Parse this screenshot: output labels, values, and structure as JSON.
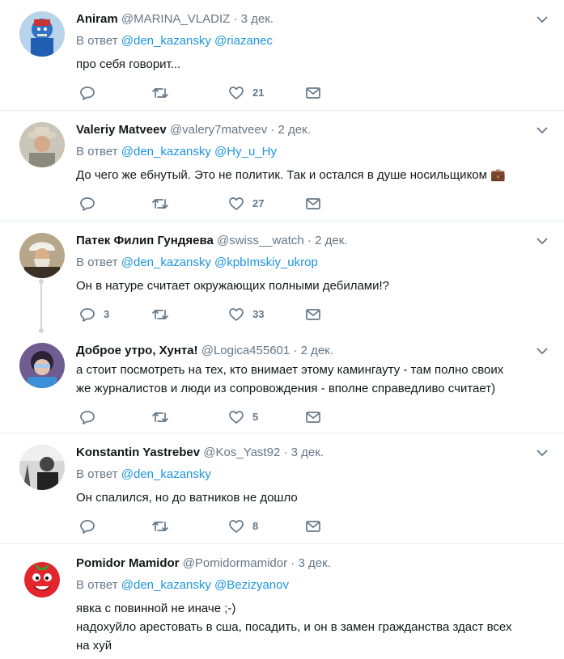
{
  "reply_prefix": "В ответ",
  "tweets": [
    {
      "name": "Aniram",
      "handle": "@MARINA_VLADIZ",
      "separator": "·",
      "time": "3 дек.",
      "mentions": [
        "@den_kazansky",
        "@riazanec"
      ],
      "lines": [
        "про себя говорит..."
      ],
      "replies": "",
      "likes": "21"
    },
    {
      "name": "Valeriy Matveev",
      "handle": "@valery7matveev",
      "separator": "·",
      "time": "2 дек.",
      "mentions": [
        "@den_kazansky",
        "@Hy_u_Hy"
      ],
      "lines": [
        "До чего же ебнутый. Это не политик. Так и остался в душе носильщиком"
      ],
      "emoji": "💼",
      "replies": "",
      "likes": "27"
    },
    {
      "name": "Патек Филип Гундяева",
      "handle": "@swiss__watch",
      "separator": "·",
      "time": "2 дек.",
      "mentions": [
        "@den_kazansky",
        "@kpbImskiy_ukrop"
      ],
      "lines": [
        "Он в натуре считает окружающих полными дебилами!?"
      ],
      "replies": "3",
      "likes": "33"
    },
    {
      "name": "Доброе утро, Хунта!",
      "handle": "@Logica455601",
      "separator": "·",
      "time": "2 дек.",
      "mentions": [],
      "lines": [
        "а стоит посмотреть на тех, кто внимает этому камингауту - там полно своих",
        "же журналистов и люди из сопровождения - вполне справедливо считает)"
      ],
      "replies": "",
      "likes": "5"
    },
    {
      "name": "Konstantin Yastrebev",
      "handle": "@Kos_Yast92",
      "separator": "·",
      "time": "3 дек.",
      "mentions": [
        "@den_kazansky"
      ],
      "lines": [
        "Он спалился, но до ватников не дошло"
      ],
      "replies": "",
      "likes": "8"
    },
    {
      "name": "Pomidor Mamidor",
      "handle": "@Pomidormamidor",
      "separator": "·",
      "time": "3 дек.",
      "mentions": [
        "@den_kazansky",
        "@Bezizyanov"
      ],
      "lines": [
        "явка с повинной не иначе ;-)",
        "надохуйло арестовать в сша, посадить, и он в замен гражданства здаст всех",
        "на хуй"
      ]
    }
  ]
}
